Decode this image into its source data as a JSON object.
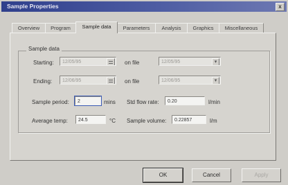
{
  "window": {
    "title": "Sample Properties",
    "close_label": "x"
  },
  "tabs": [
    {
      "label": "Overview",
      "active": false
    },
    {
      "label": "Program",
      "active": false
    },
    {
      "label": "Sample data",
      "active": true
    },
    {
      "label": "Parameters",
      "active": false
    },
    {
      "label": "Analysis",
      "active": false
    },
    {
      "label": "Graphics",
      "active": false
    },
    {
      "label": "Miscellaneous",
      "active": false
    }
  ],
  "sample_data": {
    "group_title": "Sample data",
    "starting_label": "Starting:",
    "starting_value": "12/05/95",
    "starting_on_label": "on file",
    "starting_on_value": "12/05/95",
    "ending_label": "Ending:",
    "ending_value": "12/06/95",
    "ending_on_label": "on file",
    "ending_on_value": "12/06/95",
    "period_label": "Sample period:",
    "period_value": "2",
    "period_unit": "mins",
    "flow_label": "Std flow rate:",
    "flow_value": "0.20",
    "flow_unit": "l/min",
    "temp_label": "Average temp:",
    "temp_value": "24.5",
    "temp_unit": "°C",
    "volume_label": "Sample volume:",
    "volume_value": "0.22857",
    "volume_unit": "l/m"
  },
  "buttons": {
    "ok": "OK",
    "cancel": "Cancel",
    "apply": "Apply"
  }
}
